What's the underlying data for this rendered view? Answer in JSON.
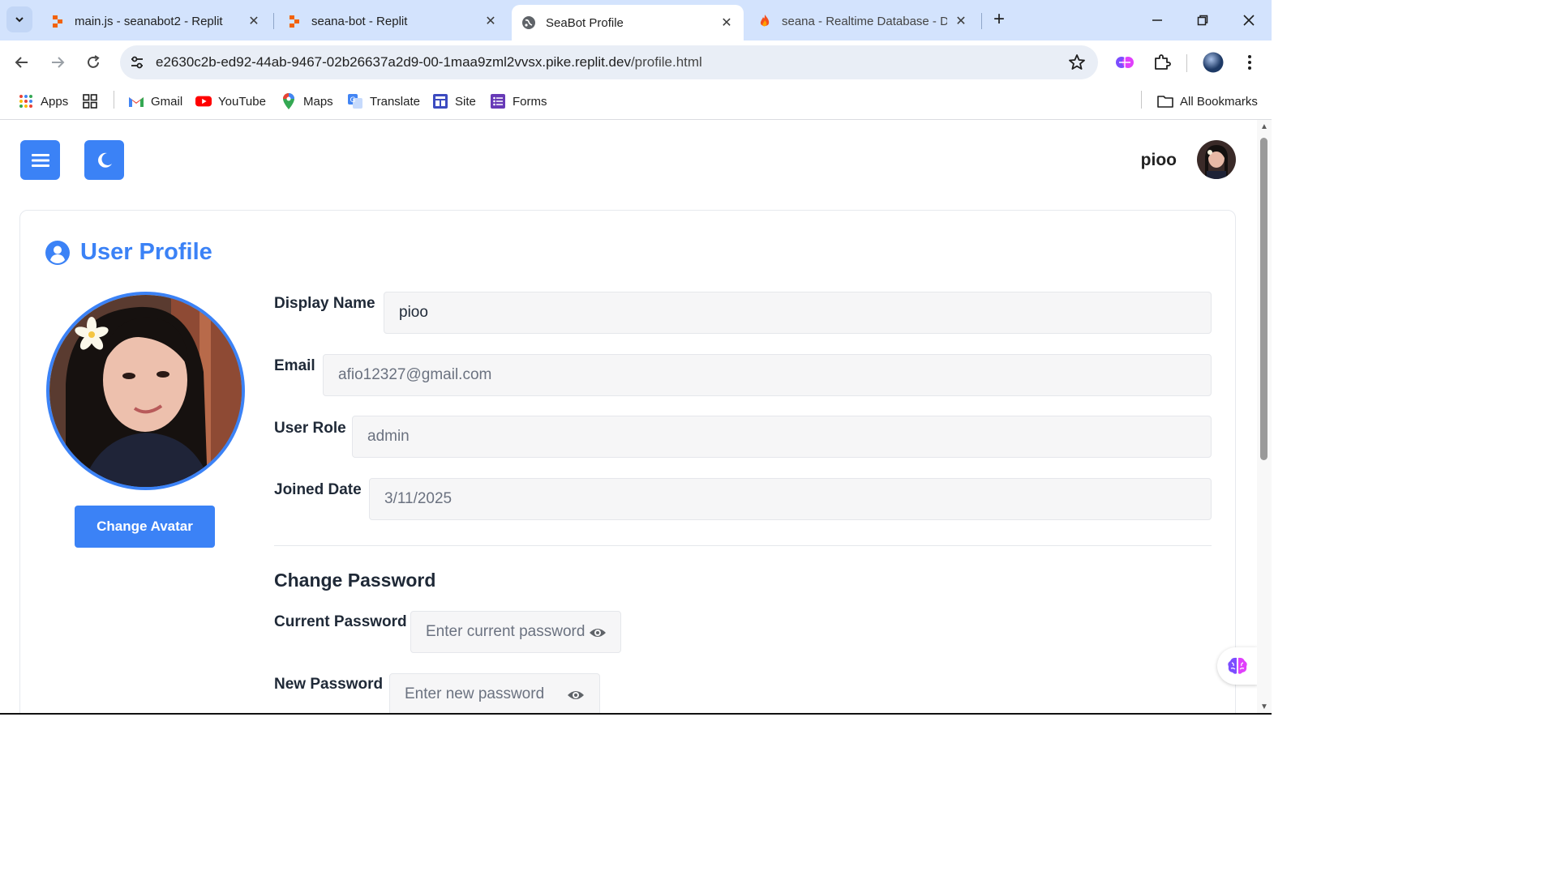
{
  "browser": {
    "tabs": [
      {
        "title": "main.js - seanabot2 - Replit",
        "icon": "replit-icon"
      },
      {
        "title": "seana-bot - Replit",
        "icon": "replit-icon"
      },
      {
        "title": "SeaBot Profile",
        "icon": "globe-icon"
      },
      {
        "title": "seana - Realtime Database - Da",
        "icon": "firebase-icon"
      }
    ],
    "url": {
      "host": "e2630c2b-ed92-44ab-9467-02b26637a2d9-00-1maa9zml2vvsx.pike.replit.dev",
      "path": "/profile.html"
    },
    "bookmarks": [
      "Apps",
      "Gmail",
      "YouTube",
      "Maps",
      "Translate",
      "Site",
      "Forms"
    ],
    "all_bookmarks": "All Bookmarks"
  },
  "header": {
    "username": "pioo"
  },
  "profile": {
    "title": "User Profile",
    "change_avatar": "Change Avatar",
    "fields": {
      "display_name": {
        "label": "Display Name",
        "value": "pioo"
      },
      "email": {
        "label": "Email",
        "value": "afio12327@gmail.com"
      },
      "role": {
        "label": "User Role",
        "value": "admin"
      },
      "joined": {
        "label": "Joined Date",
        "value": "3/11/2025"
      }
    }
  },
  "password": {
    "heading": "Change Password",
    "current": {
      "label": "Current Password",
      "placeholder": "Enter current password"
    },
    "new": {
      "label": "New Password",
      "placeholder": "Enter new password"
    }
  },
  "colors": {
    "accent": "#3b82f6",
    "chrome_tabstrip": "#d3e3fd"
  }
}
